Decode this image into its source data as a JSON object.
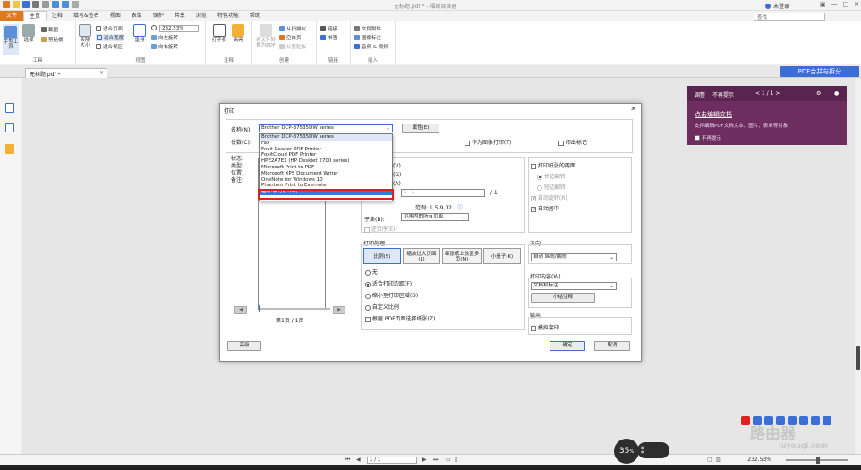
{
  "window": {
    "title": "无标题.pdf * - 福昕阅读器",
    "login": "未登录",
    "search_placeholder": "查找"
  },
  "menu": {
    "items": [
      "文件",
      "主页",
      "注释",
      "填写&签名",
      "视图",
      "表单",
      "保护",
      "共享",
      "浏览",
      "特色功能",
      "帮助"
    ]
  },
  "ribbon": {
    "hand_tool": "手型工具",
    "select": "选择",
    "screenshot": "截图",
    "clipboard": "剪贴板",
    "tools_group": "工具",
    "actual_size": "实际大小",
    "fit_page": "适合页面",
    "fit_width": "适合宽度",
    "fit_visible": "适合视区",
    "reflow": "重排",
    "zoom_value": "232.53%",
    "rotate_left": "向左旋转",
    "rotate_right": "向右旋转",
    "view_group": "视图",
    "typewriter": "打字机",
    "highlight": "高亮",
    "annot_group": "注释",
    "convert_pdf": "将文件转换为PDF",
    "from_scanner": "从扫描仪",
    "blank_page": "空白页",
    "from_clipboard": "从剪贴板",
    "create_group": "创建",
    "link": "链接",
    "bookmark": "书签",
    "link_group": "链接",
    "file_attach": "文件附件",
    "image_annot": "图像标注",
    "audio_video": "音频 & 视频",
    "insert_group": "插入"
  },
  "tab": {
    "doc_name": "无标题.pdf *",
    "merge_button": "PDF合并与拆分"
  },
  "edit_panel": {
    "tab1": "调整",
    "tab2": "不再提示",
    "page_counter": "< 1 / 1 >",
    "link": "点击编辑文档",
    "description": "支持编辑PDF文档文本、图片、表单等对象",
    "no_remind": "不再提示"
  },
  "dialog": {
    "title": "打印",
    "name_label": "名称(N):",
    "selected_printer": "Brother DCP-B7535DW series",
    "properties_button": "属性(E)",
    "copies_label": "份数(C):",
    "print_as_image": "作为图像打印(T)",
    "print_marks": "印出标记",
    "status_label": "状态:",
    "type_label": "类型:",
    "location_label": "位置:",
    "comment_label": "备注:",
    "printers": [
      "Brother DCP-B7535DW series",
      "Fax",
      "Foxit Reader PDF Printer",
      "FoxitCloud PDF Printer",
      "HPE2A7E1 (HP DeskJet 2700 series)",
      "Microsoft Print to PDF",
      "Microsoft XPS Document Writer",
      "OneNote for Windows 10",
      "Phantom Print to Evernote",
      "福昕·装订打印机"
    ],
    "range": {
      "opt1": "(V)",
      "opt2": "(G)",
      "opt3": "(A)",
      "page_input": "1 - 1",
      "page_total": "/ 1",
      "example": "范例: 1,5-9,12",
      "subset_label": "子集(B):",
      "subset_value": "范围内的所有页面",
      "reverse": "逆页序(E)"
    },
    "duplex": {
      "label": "打印纸张的两面",
      "long_edge": "长边翻转",
      "short_edge": "短边翻转",
      "auto_rotate": "自动旋转(R)",
      "auto_center": "自动居中"
    },
    "handling": {
      "title": "打印处理",
      "scale": "比例(S)",
      "tile_large": "缩放过大页面(L)",
      "multi_page": "每张纸上放置多页(M)",
      "booklet": "小册子(K)",
      "none": "无",
      "fit_printable": "适合打印边距(F)",
      "shrink_printable": "缩小至打印区域(D)",
      "custom_scale": "自定义比例",
      "choose_paper": "根据 PDF页面选择纸张(Z)"
    },
    "orientation": {
      "title": "方向",
      "value": "自动 纵向/横向"
    },
    "content": {
      "title": "打印内容(W)",
      "value": "文档和标注",
      "summary_button": "小结注释"
    },
    "output": {
      "title": "输出",
      "simulate": "模拟套印"
    },
    "preview_page": "第1页 / 1页",
    "advanced_button": "高级",
    "ok_button": "确定",
    "cancel_button": "取消"
  },
  "status": {
    "page_box": "1 / 1",
    "zoom": "232.53%"
  },
  "overlay": {
    "percent": "35",
    "unit": "%"
  },
  "watermark": {
    "main": "路由器",
    "sub": "luyouqi.com"
  },
  "colors": {
    "file_menu": "#e0781e",
    "accent": "#3b6fd6",
    "edit_panel": "#6d2e5f",
    "highlight_red": "#e02020"
  }
}
